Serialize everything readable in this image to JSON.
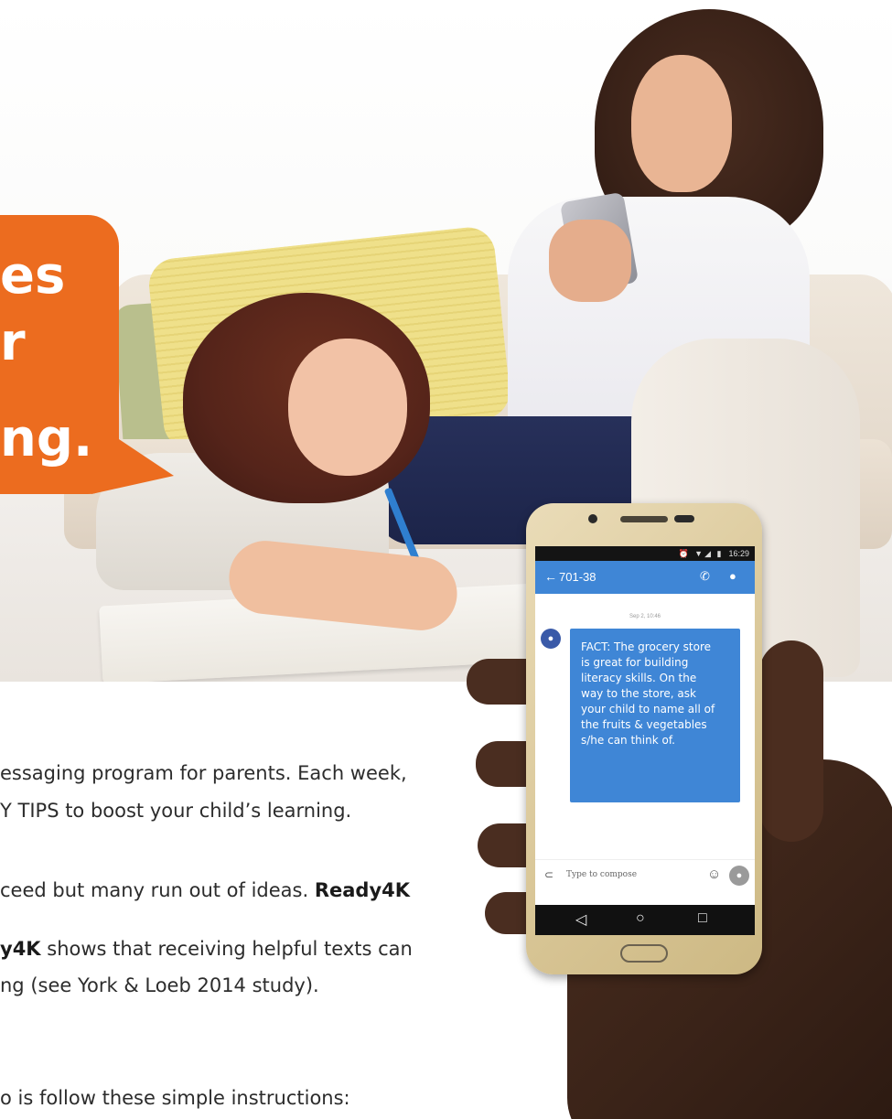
{
  "badge": {
    "line1": "es",
    "line2": "r",
    "line3": "ng."
  },
  "body_text": {
    "p1_line1": "essaging program for parents. Each week,",
    "p1_line2": "Y TIPS to boost your child’s learning.",
    "p2_line1_a": "ceed but many run out of ideas. ",
    "p2_line1_b": "Ready4K",
    "p2_line2_a": "y4K",
    "p2_line2_b": " shows that receiving helpful texts can",
    "p2_line3": "ng (see York & Loeb 2014 study).",
    "p3_line1": "o is follow these simple instructions:"
  },
  "phone": {
    "status_time": "16:29",
    "status_icons": "⏰ ▼◢ ▮",
    "contact": "701-38",
    "message_date": "Sep 2, 10:46",
    "message_lines": [
      "FACT: The grocery store",
      "is great for building",
      "literacy skills. On the",
      "way to the store, ask",
      "your child to name all of",
      "the fruits & vegetables",
      "s/he can think of."
    ],
    "compose_placeholder": "Type to compose",
    "icons": {
      "back": "back-arrow-icon",
      "call": "phone-call-icon",
      "contact": "person-icon",
      "attach": "paperclip-icon",
      "emoji": "smiley-icon",
      "send": "send-icon"
    }
  },
  "colors": {
    "badge_orange": "#ec6c1f",
    "app_blue": "#3f86d6",
    "text": "#2c2c2c"
  }
}
